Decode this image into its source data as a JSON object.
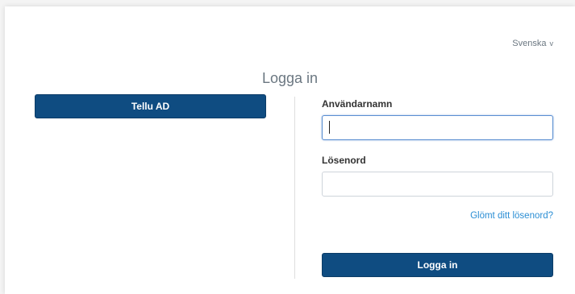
{
  "language": {
    "selected": "Svenska",
    "chevron": "v"
  },
  "page": {
    "title": "Logga in"
  },
  "sso": {
    "button_label": "Tellu AD"
  },
  "form": {
    "username_label": "Användarnamn",
    "username_value": "",
    "password_label": "Lösenord",
    "password_value": "",
    "forgot_link": "Glömt ditt lösenord?",
    "submit_label": "Logga in"
  },
  "colors": {
    "primary_button": "#0f4c81",
    "link": "#2b8ed4",
    "focus_border": "#5a8ed1"
  }
}
